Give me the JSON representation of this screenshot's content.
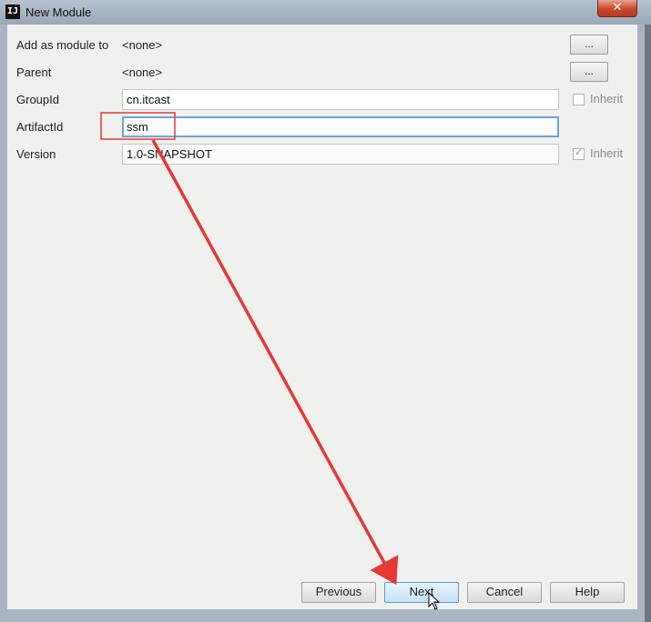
{
  "window": {
    "title": "New Module",
    "app_icon_text": "IJ",
    "close_glyph": "✕"
  },
  "form": {
    "add_as_module_to": {
      "label": "Add as module to",
      "value": "<none>",
      "button": "..."
    },
    "parent": {
      "label": "Parent",
      "value": "<none>",
      "button": "..."
    },
    "group_id": {
      "label": "GroupId",
      "value": "cn.itcast",
      "inherit_label": "Inherit",
      "inherit_checked": false
    },
    "artifact_id": {
      "label": "ArtifactId",
      "value": "ssm"
    },
    "version": {
      "label": "Version",
      "value": "1.0-SNAPSHOT",
      "inherit_label": "Inherit",
      "inherit_checked": true
    }
  },
  "buttons": {
    "previous": "Previous",
    "next": "Next",
    "cancel": "Cancel",
    "help": "Help"
  },
  "annotation": {
    "color": "#e53935",
    "box_target": "artifact-id-field",
    "arrow_target": "next-button"
  },
  "cursor_icon": "arrow-cursor-icon"
}
